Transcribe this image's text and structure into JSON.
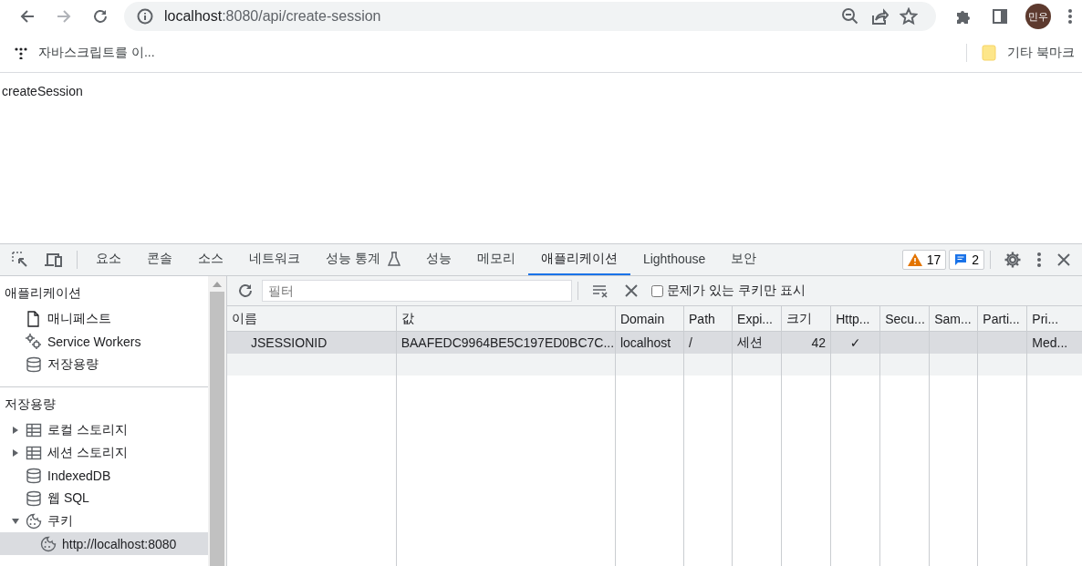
{
  "browser": {
    "url_host": "localhost",
    "url_rest": ":8080/api/create-session",
    "profile": "민우",
    "bookmarks": [
      {
        "label": "자바스크립트를 이..."
      }
    ],
    "other_bookmarks": "기타 북마크"
  },
  "page": {
    "text": "createSession"
  },
  "devtools": {
    "tabs": [
      {
        "label": "요소",
        "selected": false
      },
      {
        "label": "콘솔",
        "selected": false
      },
      {
        "label": "소스",
        "selected": false
      },
      {
        "label": "네트워크",
        "selected": false
      },
      {
        "label": "성능 통계",
        "selected": false,
        "experimental": true
      },
      {
        "label": "성능",
        "selected": false
      },
      {
        "label": "메모리",
        "selected": false
      },
      {
        "label": "애플리케이션",
        "selected": true
      },
      {
        "label": "Lighthouse",
        "selected": false
      },
      {
        "label": "보안",
        "selected": false
      }
    ],
    "warnings": "17",
    "messages": "2",
    "sidebar": {
      "sections": [
        {
          "title": "애플리케이션",
          "items": [
            {
              "label": "매니페스트",
              "kind": "file",
              "selected": false
            },
            {
              "label": "Service Workers",
              "kind": "gears",
              "selected": false
            },
            {
              "label": "저장용량",
              "kind": "database",
              "selected": false
            }
          ]
        },
        {
          "title": "저장용량",
          "items": [
            {
              "label": "로컬 스토리지",
              "kind": "table",
              "selected": false,
              "expanded": false
            },
            {
              "label": "세션 스토리지",
              "kind": "table",
              "selected": false,
              "expanded": false
            },
            {
              "label": "IndexedDB",
              "kind": "database",
              "selected": false
            },
            {
              "label": "웹 SQL",
              "kind": "database",
              "selected": false
            },
            {
              "label": "쿠키",
              "kind": "cookie",
              "selected": false,
              "expanded": true,
              "children": [
                {
                  "label": "http://localhost:8080",
                  "kind": "cookie",
                  "selected": true
                }
              ]
            }
          ]
        }
      ]
    },
    "toolbar": {
      "filter_placeholder": "필터",
      "only_issues": {
        "label": "문제가 있는 쿠키만 표시",
        "checked": false
      }
    },
    "table": {
      "columns": [
        "이름",
        "값",
        "Domain",
        "Path",
        "Expi...",
        "크기",
        "Http...",
        "Secu...",
        "Sam...",
        "Parti...",
        "Pri..."
      ],
      "rows": [
        {
          "selected": true,
          "cells": [
            "JSESSIONID",
            "BAAFEDC9964BE5C197ED0BC7C...",
            "localhost",
            "/",
            "세션",
            "42",
            "✓",
            "",
            "",
            "",
            "Med..."
          ]
        }
      ]
    }
  }
}
